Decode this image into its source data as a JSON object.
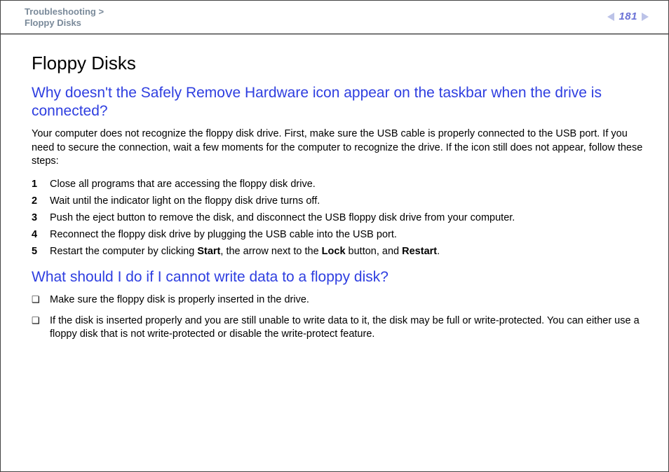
{
  "header": {
    "breadcrumb_section": "Troubleshooting",
    "breadcrumb_sep": ">",
    "breadcrumb_page": "Floppy Disks",
    "page_number": "181"
  },
  "title": "Floppy Disks",
  "q1": {
    "heading": "Why doesn't the Safely Remove Hardware icon appear on the taskbar when the drive is connected?",
    "intro": "Your computer does not recognize the floppy disk drive. First, make sure the USB cable is properly connected to the USB port. If you need to secure the connection, wait a few moments for the computer to recognize the drive. If the icon still does not appear, follow these steps:",
    "steps": [
      {
        "n": "1",
        "text": "Close all programs that are accessing the floppy disk drive."
      },
      {
        "n": "2",
        "text": "Wait until the indicator light on the floppy disk drive turns off."
      },
      {
        "n": "3",
        "text": "Push the eject button to remove the disk, and disconnect the USB floppy disk drive from your computer."
      },
      {
        "n": "4",
        "text": "Reconnect the floppy disk drive by plugging the USB cable into the USB port."
      },
      {
        "n": "5",
        "pre": "Restart the computer by clicking ",
        "b1": "Start",
        "mid1": ", the arrow next to the ",
        "b2": "Lock",
        "mid2": " button, and ",
        "b3": "Restart",
        "post": "."
      }
    ]
  },
  "q2": {
    "heading": "What should I do if I cannot write data to a floppy disk?",
    "bullets": [
      "Make sure the floppy disk is properly inserted in the drive.",
      "If the disk is inserted properly and you are still unable to write data to it, the disk may be full or write-protected. You can either use a floppy disk that is not write-protected or disable the write-protect feature."
    ]
  },
  "marker": "❑"
}
